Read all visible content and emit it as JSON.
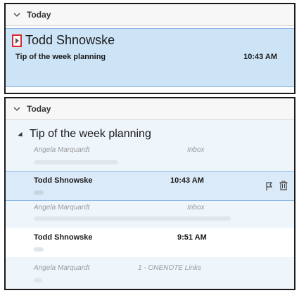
{
  "panel_top": {
    "group_label": "Today",
    "selected": {
      "sender": "Todd Shnowske",
      "subject": "Tip of the week planning",
      "time": "10:43 AM"
    }
  },
  "panel_bottom": {
    "group_label": "Today",
    "conversation_subject": "Tip of the week planning",
    "items": [
      {
        "kind": "light",
        "sender": "Angela Marquardt",
        "folder": "Inbox"
      },
      {
        "kind": "bold",
        "sender": "Todd Shnowske",
        "time": "10:43 AM"
      },
      {
        "kind": "light",
        "sender": "Angela Marquardt",
        "folder": "Inbox"
      },
      {
        "kind": "bold",
        "sender": "Todd Shnowske",
        "time": "9:51 AM"
      },
      {
        "kind": "light",
        "sender": "Angela Marquardt",
        "folder": "1 - ONENOTE Links"
      }
    ]
  },
  "icons": {
    "flag": "flag-icon",
    "delete": "trash-icon",
    "collapse": "chevron-down-icon",
    "expand": "triangle-right-icon"
  },
  "colors": {
    "selection": "#cde4f7",
    "selection_border": "#8ab7e3",
    "highlight_box": "#e0262a"
  }
}
